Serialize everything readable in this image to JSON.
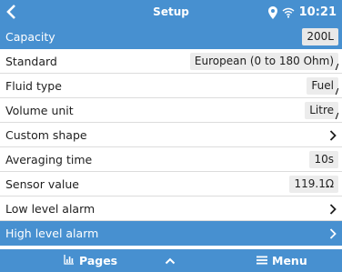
{
  "statusbar": {
    "back_icon": "back-chevron-icon",
    "title": "Setup",
    "time": "10:21"
  },
  "rows": [
    {
      "label": "Capacity",
      "value": "200L",
      "selected": true,
      "control": "value"
    },
    {
      "label": "Standard",
      "value": "European (0 to 180 Ohm)",
      "control": "value"
    },
    {
      "label": "Fluid type",
      "value": "Fuel",
      "control": "value"
    },
    {
      "label": "Volume unit",
      "value": "Litre",
      "control": "value"
    },
    {
      "label": "Custom shape",
      "value": "",
      "control": "chevron"
    },
    {
      "label": "Averaging time",
      "value": "10s",
      "control": "value"
    },
    {
      "label": "Sensor value",
      "value": "119.1Ω",
      "control": "value"
    },
    {
      "label": "Low level alarm",
      "value": "",
      "control": "chevron"
    },
    {
      "label": "High level alarm",
      "value": "",
      "selected": true,
      "control": "chevron"
    }
  ],
  "bottombar": {
    "pages_label": "Pages",
    "menu_label": "Menu"
  },
  "colors": {
    "accent": "#4790d0",
    "value_bg": "#ececec",
    "divider": "#dcdcdc"
  }
}
